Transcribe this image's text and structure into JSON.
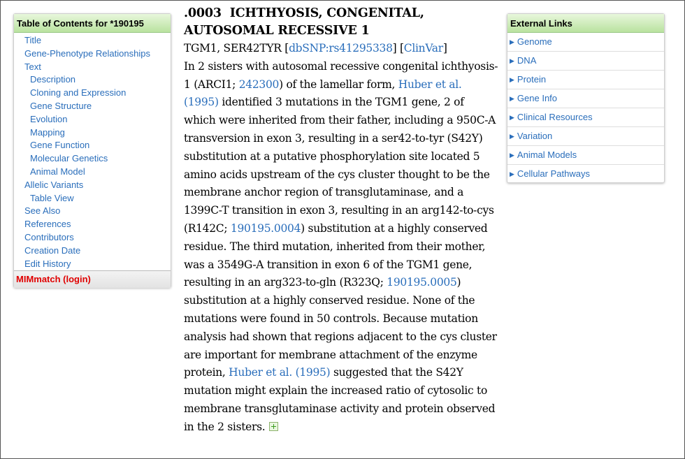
{
  "toc": {
    "title": "Table of Contents for *190195",
    "items": [
      {
        "label": "Title",
        "level": 1
      },
      {
        "label": "Gene-Phenotype Relationships",
        "level": 1
      },
      {
        "label": "Text",
        "level": 1
      },
      {
        "label": "Description",
        "level": 2
      },
      {
        "label": "Cloning and Expression",
        "level": 2
      },
      {
        "label": "Gene Structure",
        "level": 2
      },
      {
        "label": "Evolution",
        "level": 2
      },
      {
        "label": "Mapping",
        "level": 2
      },
      {
        "label": "Gene Function",
        "level": 2
      },
      {
        "label": "Molecular Genetics",
        "level": 2
      },
      {
        "label": "Animal Model",
        "level": 2
      },
      {
        "label": "Allelic Variants",
        "level": 1
      },
      {
        "label": "Table View",
        "level": 2
      },
      {
        "label": "See Also",
        "level": 1
      },
      {
        "label": "References",
        "level": 1
      },
      {
        "label": "Contributors",
        "level": 1
      },
      {
        "label": "Creation Date",
        "level": 1
      },
      {
        "label": "Edit History",
        "level": 1
      }
    ],
    "mimmatch": "MIMmatch (login)"
  },
  "external_links": {
    "title": "External Links",
    "items": [
      "Genome",
      "DNA",
      "Protein",
      "Gene Info",
      "Clinical Resources",
      "Variation",
      "Animal Models",
      "Cellular Pathways"
    ]
  },
  "variant": {
    "number": ".0003",
    "title_line1": "ICHTHYOSIS, CONGENITAL,",
    "title_line2": "AUTOSOMAL RECESSIVE 1",
    "gene_line": {
      "prefix": "TGM1, SER42TYR [",
      "dbsnp": "dbSNP:rs41295338",
      "mid": "] [",
      "clinvar": "ClinVar",
      "suffix": "]"
    },
    "paragraph": [
      {
        "text": "In 2 sisters with autosomal recessive congenital ichthyosis-1 (ARCI1; "
      },
      {
        "link": "242300"
      },
      {
        "text": ") of the lamellar form, "
      },
      {
        "link": "Huber et al. (1995)"
      },
      {
        "text": " identified 3 mutations in the TGM1 gene, 2 of which were inherited from their father, including a 950C-A transversion in exon 3, resulting in a ser42-to-tyr (S42Y) substitution at a putative phosphorylation site located 5 amino acids upstream of the cys cluster thought to be the membrane anchor region of transglutaminase, and a 1399C-T transition in exon 3, resulting in an arg142-to-cys (R142C; "
      },
      {
        "link": "190195.0004"
      },
      {
        "text": ") substitution at a highly conserved residue. The third mutation, inherited from their mother, was a 3549G-A transition in exon 6 of the TGM1 gene, resulting in an arg323-to-gln (R323Q; "
      },
      {
        "link": "190195.0005"
      },
      {
        "text": ") substitution at a highly conserved residue. None of the mutations were found in 50 controls. Because mutation analysis had shown that regions adjacent to the cys cluster are important for membrane attachment of the enzyme protein, "
      },
      {
        "link": "Huber et al. (1995)"
      },
      {
        "text": " suggested that the S42Y mutation might explain the increased ratio of cytosolic to membrane transglutaminase activity and protein observed in the 2 sisters."
      }
    ]
  }
}
